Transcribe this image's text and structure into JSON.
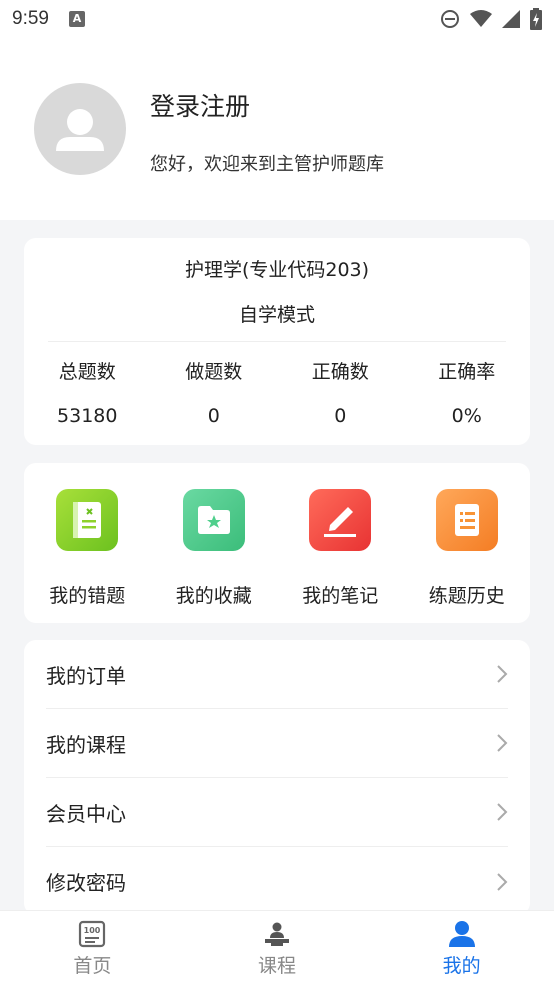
{
  "status": {
    "time": "9:59"
  },
  "profile": {
    "login_title": "登录注册",
    "welcome": "您好，欢迎来到主管护师题库"
  },
  "stats": {
    "subject": "护理学(专业代码203)",
    "mode": "自学模式",
    "items": [
      {
        "label": "总题数",
        "value": "53180"
      },
      {
        "label": "做题数",
        "value": "0"
      },
      {
        "label": "正确数",
        "value": "0"
      },
      {
        "label": "正确率",
        "value": "0%"
      }
    ]
  },
  "tools": [
    {
      "label": "我的错题",
      "icon": "wrong-questions-icon",
      "color": "#8ed12b"
    },
    {
      "label": "我的收藏",
      "icon": "favorites-icon",
      "color": "#4fcf8c"
    },
    {
      "label": "我的笔记",
      "icon": "notes-icon",
      "color": "#f24a45"
    },
    {
      "label": "练题历史",
      "icon": "history-icon",
      "color": "#f89436"
    }
  ],
  "menu": [
    {
      "label": "我的订单"
    },
    {
      "label": "我的课程"
    },
    {
      "label": "会员中心"
    },
    {
      "label": "修改密码"
    }
  ],
  "nav": [
    {
      "label": "首页",
      "icon": "home-icon"
    },
    {
      "label": "课程",
      "icon": "course-icon"
    },
    {
      "label": "我的",
      "icon": "profile-icon",
      "active": true
    }
  ],
  "colors": {
    "accent": "#1a73e8"
  }
}
